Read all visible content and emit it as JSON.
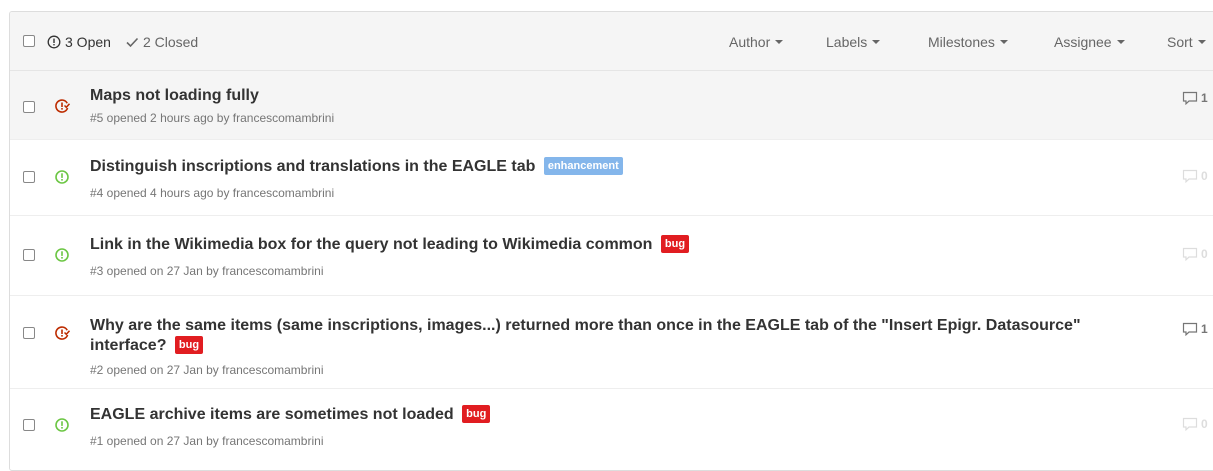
{
  "header": {
    "open_label": "3 Open",
    "closed_label": "2 Closed",
    "filters": [
      "Author",
      "Labels",
      "Milestones",
      "Assignee",
      "Sort"
    ]
  },
  "colors": {
    "closed_icon": "#bd2c00",
    "open_icon": "#6cc644",
    "enhancement": "#84b6eb",
    "bug": "#e11d21"
  },
  "issues": [
    {
      "state": "closed",
      "title": "Maps not loading fully",
      "labels": [],
      "meta": "#5 opened 2 hours ago by francescomambrini",
      "comments": "1"
    },
    {
      "state": "open",
      "title": "Distinguish inscriptions and translations in the EAGLE tab",
      "labels": [
        "enhancement"
      ],
      "meta": "#4 opened 4 hours ago by francescomambrini",
      "comments": "0"
    },
    {
      "state": "open",
      "title": "Link in the Wikimedia box for the query not leading to Wikimedia common",
      "labels": [
        "bug"
      ],
      "meta": "#3 opened on 27 Jan by francescomambrini",
      "comments": "0"
    },
    {
      "state": "closed",
      "title": "Why are the same items (same inscriptions, images...) returned more than once in the EAGLE tab of the \"Insert Epigr. Datasource\" interface?",
      "labels": [
        "bug"
      ],
      "meta": "#2 opened on 27 Jan by francescomambrini",
      "comments": "1"
    },
    {
      "state": "open",
      "title": "EAGLE archive items are sometimes not loaded",
      "labels": [
        "bug"
      ],
      "meta": "#1 opened on 27 Jan by francescomambrini",
      "comments": "0"
    }
  ]
}
